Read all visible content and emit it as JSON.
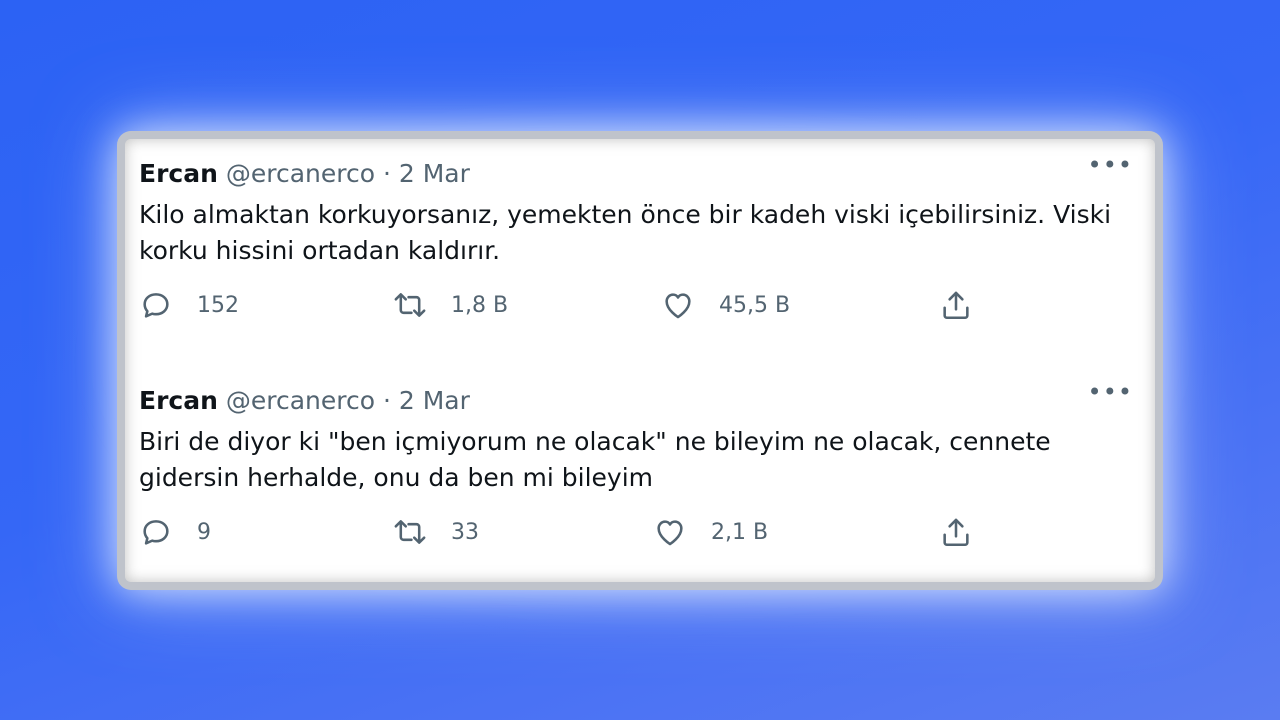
{
  "tweets": [
    {
      "name": "Ercan",
      "handle": "@ercanerco",
      "separator": " · ",
      "date": "2 Mar",
      "more_label": "•••",
      "text": "Kilo almaktan korkuyorsanız, yemekten önce bir kadeh viski içebilirsiniz. Viski korku hissini ortadan kaldırır.",
      "replies": "152",
      "retweets": "1,8 B",
      "likes": "45,5 B"
    },
    {
      "name": "Ercan",
      "handle": "@ercanerco",
      "separator": " · ",
      "date": "2 Mar",
      "more_label": "•••",
      "text": "Biri de diyor ki \"ben içmiyorum ne olacak\" ne bileyim ne olacak, cennete gidersin herhalde, onu da ben mi bileyim",
      "replies": "9",
      "retweets": "33",
      "likes": "2,1 B"
    }
  ],
  "icons": {
    "reply": "reply-icon",
    "retweet": "retweet-icon",
    "like": "heart-icon",
    "share": "share-icon"
  },
  "colors": {
    "background": "#2c62f4",
    "text": "#0f1419",
    "muted": "#536471"
  }
}
